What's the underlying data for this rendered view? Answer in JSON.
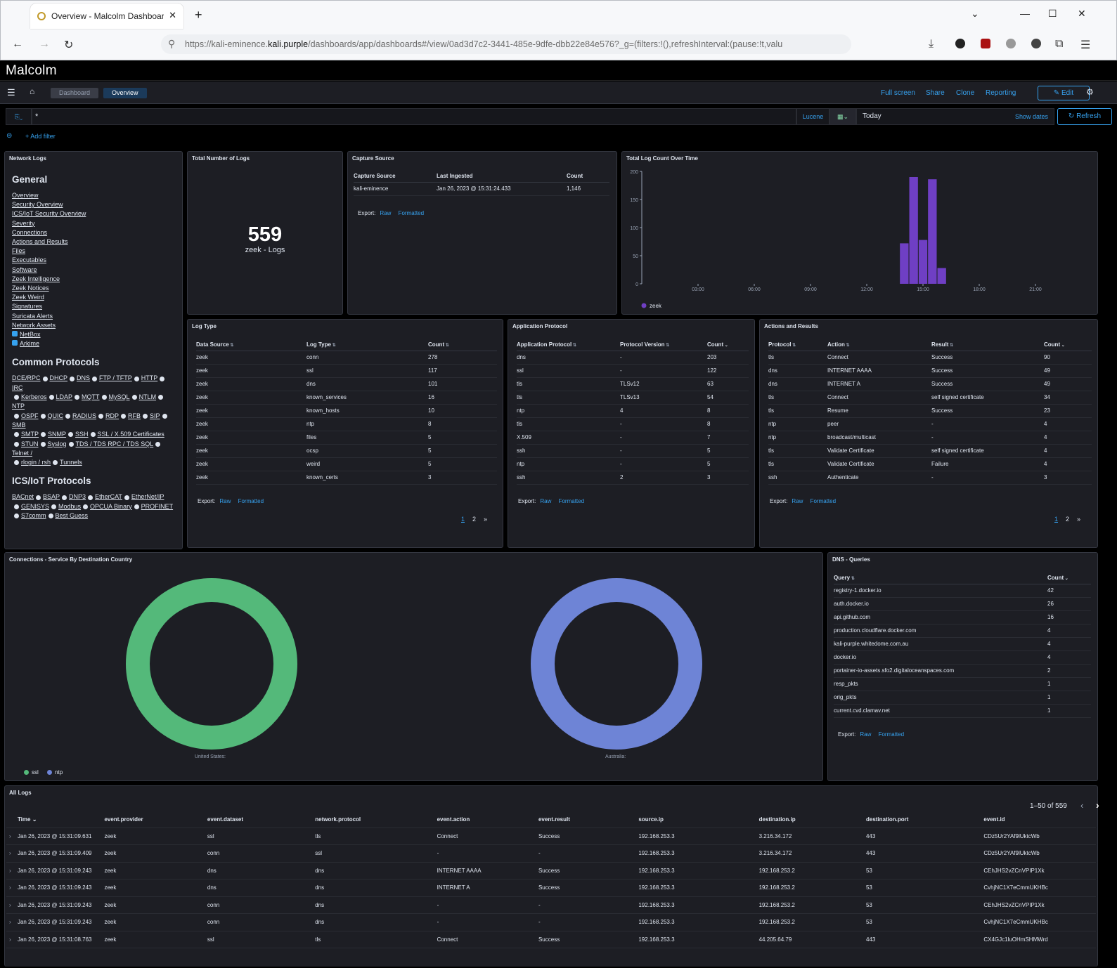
{
  "browser": {
    "tab_title": "Overview - Malcolm Dashboard",
    "url_prefix": "https://kali-eminence.",
    "url_host": "kali.purple",
    "url_rest": "/dashboards/app/dashboards#/view/0ad3d7c2-3441-485e-9dfe-dbb22e84e576?_g=(filters:!(),refreshInterval:(pause:!t,valu"
  },
  "app": {
    "logo": "Malcolm",
    "breadcrumbs": [
      "Dashboard",
      "Overview"
    ],
    "toplinks": [
      "Full screen",
      "Share",
      "Clone",
      "Reporting"
    ],
    "edit_label": "Edit",
    "query_value": "*",
    "lucene": "Lucene",
    "time_label": "Today",
    "show_dates": "Show dates",
    "refresh": "Refresh",
    "add_filter": "+ Add filter"
  },
  "network_logs": {
    "title": "Network Logs",
    "general_heading": "General",
    "general_links": [
      "Overview",
      "Security Overview",
      "ICS/IoT Security Overview",
      "Severity",
      "Connections",
      "Actions and Results",
      "Files",
      "Executables",
      "Software",
      "Zeek Intelligence",
      "Zeek Notices",
      "Zeek Weird",
      "Signatures",
      "Suricata Alerts",
      "Network Assets"
    ],
    "external_links": [
      "NetBox",
      "Arkime"
    ],
    "common_heading": "Common Protocols",
    "common_lines": [
      [
        "DCE/RPC",
        "DHCP",
        "DNS",
        "FTP / TFTP",
        "HTTP",
        "IRC"
      ],
      [
        "Kerberos",
        "LDAP",
        "MQTT",
        "MySQL",
        "NTLM",
        "NTP"
      ],
      [
        "OSPF",
        "QUIC",
        "RADIUS",
        "RDP",
        "RFB",
        "SIP",
        "SMB"
      ],
      [
        "SMTP",
        "SNMP",
        "SSH",
        "SSL / X.509 Certificates"
      ],
      [
        "STUN",
        "Syslog",
        "TDS / TDS RPC / TDS SQL",
        "Telnet /"
      ],
      [
        "rlogin / rsh",
        "Tunnels"
      ]
    ],
    "ics_heading": "ICS/IoT Protocols",
    "ics_lines": [
      [
        "BACnet",
        "BSAP",
        "DNP3",
        "EtherCAT",
        "EtherNet/IP"
      ],
      [
        "GENISYS",
        "Modbus",
        "OPCUA Binary",
        "PROFINET"
      ],
      [
        "S7comm",
        "Best Guess"
      ]
    ]
  },
  "total_logs": {
    "title": "Total Number of Logs",
    "value": "559",
    "label": "zeek - Logs"
  },
  "capture_source": {
    "title": "Capture Source",
    "headers": [
      "Capture Source",
      "Last Ingested",
      "Count"
    ],
    "rows": [
      [
        "kali-eminence",
        "Jan 26, 2023 @ 15:31:24.433",
        "1,146"
      ]
    ],
    "export": "Export:",
    "raw": "Raw",
    "formatted": "Formatted"
  },
  "chart_data": {
    "type": "bar",
    "title": "Total Log Count Over Time",
    "x_ticks": [
      "03:00",
      "06:00",
      "09:00",
      "12:00",
      "15:00",
      "18:00",
      "21:00"
    ],
    "y_ticks": [
      "0",
      "50",
      "100",
      "150",
      "200"
    ],
    "ylim": [
      0,
      200
    ],
    "series": [
      {
        "name": "zeek",
        "color": "#6f3fc4",
        "x": [
          "14:00",
          "14:30",
          "15:00",
          "15:30",
          "16:00"
        ],
        "values": [
          72,
          190,
          78,
          186,
          28
        ]
      }
    ],
    "legend": "bottom-left"
  },
  "log_type": {
    "title": "Log Type",
    "headers": [
      "Data Source",
      "Log Type",
      "Count"
    ],
    "rows": [
      [
        "zeek",
        "conn",
        "278"
      ],
      [
        "zeek",
        "ssl",
        "117"
      ],
      [
        "zeek",
        "dns",
        "101"
      ],
      [
        "zeek",
        "known_services",
        "16"
      ],
      [
        "zeek",
        "known_hosts",
        "10"
      ],
      [
        "zeek",
        "ntp",
        "8"
      ],
      [
        "zeek",
        "files",
        "5"
      ],
      [
        "zeek",
        "ocsp",
        "5"
      ],
      [
        "zeek",
        "weird",
        "5"
      ],
      [
        "zeek",
        "known_certs",
        "3"
      ]
    ],
    "export": "Export:",
    "raw": "Raw",
    "formatted": "Formatted",
    "pages": [
      "1",
      "2",
      "»"
    ]
  },
  "app_protocol": {
    "title": "Application Protocol",
    "headers": [
      "Application Protocol",
      "Protocol Version",
      "Count"
    ],
    "rows": [
      [
        "dns",
        "-",
        "203"
      ],
      [
        "ssl",
        "-",
        "122"
      ],
      [
        "tls",
        "TLSv12",
        "63"
      ],
      [
        "tls",
        "TLSv13",
        "54"
      ],
      [
        "ntp",
        "4",
        "8"
      ],
      [
        "tls",
        "-",
        "8"
      ],
      [
        "X.509",
        "-",
        "7"
      ],
      [
        "ssh",
        "-",
        "5"
      ],
      [
        "ntp",
        "-",
        "5"
      ],
      [
        "ssh",
        "2",
        "3"
      ]
    ],
    "export": "Export:",
    "raw": "Raw",
    "formatted": "Formatted"
  },
  "actions_results": {
    "title": "Actions and Results",
    "headers": [
      "Protocol",
      "Action",
      "Result",
      "Count"
    ],
    "rows": [
      [
        "tls",
        "Connect",
        "Success",
        "90"
      ],
      [
        "dns",
        "INTERNET AAAA",
        "Success",
        "49"
      ],
      [
        "dns",
        "INTERNET A",
        "Success",
        "49"
      ],
      [
        "tls",
        "Connect",
        "self signed certificate",
        "34"
      ],
      [
        "tls",
        "Resume",
        "Success",
        "23"
      ],
      [
        "ntp",
        "peer",
        "-",
        "4"
      ],
      [
        "ntp",
        "broadcast/multicast",
        "-",
        "4"
      ],
      [
        "tls",
        "Validate Certificate",
        "self signed certificate",
        "4"
      ],
      [
        "tls",
        "Validate Certificate",
        "Failure",
        "4"
      ],
      [
        "ssh",
        "Authenticate",
        "-",
        "3"
      ]
    ],
    "export": "Export:",
    "raw": "Raw",
    "formatted": "Formatted",
    "pages": [
      "1",
      "2",
      "»"
    ]
  },
  "connections": {
    "title": "Connections - Service By Destination Country",
    "donuts": [
      {
        "label": "United States:",
        "service": "ssl",
        "color": "#54b97a"
      },
      {
        "label": "Australia:",
        "service": "ntp",
        "color": "#6e84d6"
      }
    ],
    "legend": [
      {
        "name": "ssl",
        "color": "#54b97a"
      },
      {
        "name": "ntp",
        "color": "#6e84d6"
      }
    ]
  },
  "dns_queries": {
    "title": "DNS - Queries",
    "headers": [
      "Query",
      "Count"
    ],
    "rows": [
      [
        "registry-1.docker.io",
        "42"
      ],
      [
        "auth.docker.io",
        "26"
      ],
      [
        "api.github.com",
        "16"
      ],
      [
        "production.cloudflare.docker.com",
        "4"
      ],
      [
        "kali-purple.whitedome.com.au",
        "4"
      ],
      [
        "docker.io",
        "4"
      ],
      [
        "portainer-io-assets.sfo2.digitaloceanspaces.com",
        "2"
      ],
      [
        "resp_pkts",
        "1"
      ],
      [
        "orig_pkts",
        "1"
      ],
      [
        "current.cvd.clamav.net",
        "1"
      ]
    ],
    "export": "Export:",
    "raw": "Raw",
    "formatted": "Formatted"
  },
  "all_logs": {
    "title": "All Logs",
    "range": "1–50 of 559",
    "headers": [
      "Time",
      "event.provider",
      "event.dataset",
      "network.protocol",
      "event.action",
      "event.result",
      "source.ip",
      "destination.ip",
      "destination.port",
      "event.id"
    ],
    "rows": [
      [
        "Jan 26, 2023 @ 15:31:09.631",
        "zeek",
        "ssl",
        "tls",
        "Connect",
        "Success",
        "192.168.253.3",
        "3.216.34.172",
        "443",
        "CDz5Ur2YAf9lUktcWb"
      ],
      [
        "Jan 26, 2023 @ 15:31:09.409",
        "zeek",
        "conn",
        "ssl",
        "-",
        "-",
        "192.168.253.3",
        "3.216.34.172",
        "443",
        "CDz5Ur2YAf9lUktcWb"
      ],
      [
        "Jan 26, 2023 @ 15:31:09.243",
        "zeek",
        "dns",
        "dns",
        "INTERNET AAAA",
        "Success",
        "192.168.253.3",
        "192.168.253.2",
        "53",
        "CEhJHS2vZCnVPIP1Xk"
      ],
      [
        "Jan 26, 2023 @ 15:31:09.243",
        "zeek",
        "dns",
        "dns",
        "INTERNET A",
        "Success",
        "192.168.253.3",
        "192.168.253.2",
        "53",
        "CvhjNC1X7eCmmUKHBc"
      ],
      [
        "Jan 26, 2023 @ 15:31:09.243",
        "zeek",
        "conn",
        "dns",
        "-",
        "-",
        "192.168.253.3",
        "192.168.253.2",
        "53",
        "CEhJHS2vZCnVPIP1Xk"
      ],
      [
        "Jan 26, 2023 @ 15:31:09.243",
        "zeek",
        "conn",
        "dns",
        "-",
        "-",
        "192.168.253.3",
        "192.168.253.2",
        "53",
        "CvhjNC1X7eCmmUKHBc"
      ],
      [
        "Jan 26, 2023 @ 15:31:08.763",
        "zeek",
        "ssl",
        "tls",
        "Connect",
        "Success",
        "192.168.253.3",
        "44.205.64.79",
        "443",
        "CX4GJc1luOHmSHMWrd"
      ]
    ]
  }
}
